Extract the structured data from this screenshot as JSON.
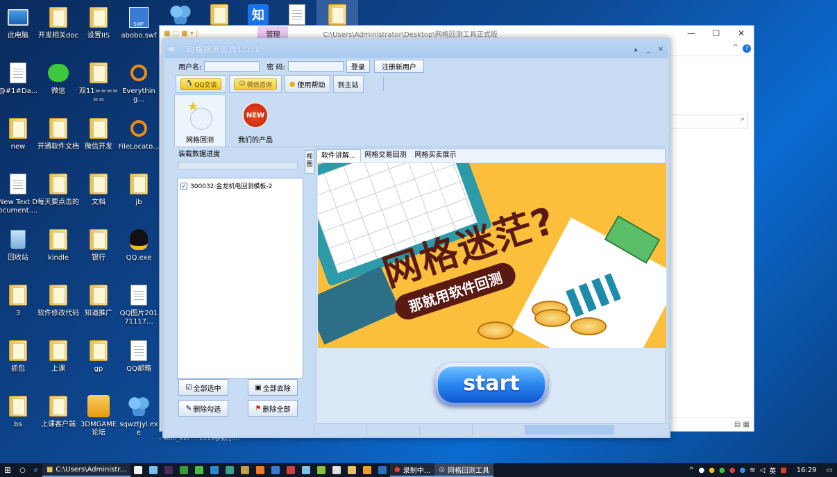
{
  "desktop_icons": [
    {
      "label": "此电脑",
      "icon": "pc-icon"
    },
    {
      "label": "开发相关doc",
      "icon": "folder-icon"
    },
    {
      "label": "设置IIS",
      "icon": "folder-icon"
    },
    {
      "label": "abobo.swf",
      "icon": "swf-icon"
    },
    {
      "label": "@#1#Da...",
      "icon": "document-icon"
    },
    {
      "label": "微信",
      "icon": "wechat-icon"
    },
    {
      "label": "双11======",
      "icon": "folder-icon"
    },
    {
      "label": "Everything...",
      "icon": "search-icon"
    },
    {
      "label": "new",
      "icon": "folder-icon"
    },
    {
      "label": "开通软件文档",
      "icon": "folder-icon"
    },
    {
      "label": "微信开发",
      "icon": "folder-icon"
    },
    {
      "label": "FileLocato...",
      "icon": "search-icon"
    },
    {
      "label": "New Text Document....",
      "icon": "document-icon"
    },
    {
      "label": "每天要点击的",
      "icon": "folder-icon"
    },
    {
      "label": "文档",
      "icon": "folder-icon"
    },
    {
      "label": "jb",
      "icon": "folder-icon"
    },
    {
      "label": "回收站",
      "icon": "recycle-bin-icon"
    },
    {
      "label": "kindle",
      "icon": "folder-icon"
    },
    {
      "label": "银行",
      "icon": "folder-icon"
    },
    {
      "label": "QQ.exe",
      "icon": "qq-icon"
    },
    {
      "label": "3",
      "icon": "folder-icon"
    },
    {
      "label": "软件修改代码",
      "icon": "folder-icon"
    },
    {
      "label": "知道推广",
      "icon": "folder-icon"
    },
    {
      "label": "QQ图片20171117...",
      "icon": "document-icon"
    },
    {
      "label": "抓包",
      "icon": "folder-icon"
    },
    {
      "label": "上课",
      "icon": "folder-icon"
    },
    {
      "label": "gp",
      "icon": "folder-icon"
    },
    {
      "label": "QQ邮箱",
      "icon": "document-icon"
    },
    {
      "label": "bs",
      "icon": "folder-icon"
    },
    {
      "label": "上课客户端",
      "icon": "folder-icon"
    },
    {
      "label": "3DMGAME论坛",
      "icon": "game-icon"
    },
    {
      "label": "sqwztjyl.exe",
      "icon": "people-icon"
    }
  ],
  "top_row_icons": [
    "知"
  ],
  "explorer": {
    "manage_label": "管理",
    "path": "C:\\Users\\Administrator\\Desktop\\网格回测工具正式版",
    "status_left": "37",
    "status_line": "- leon_kin ...          1519参数小..."
  },
  "app": {
    "title": "网格回测工具1.1.1",
    "login": {
      "username_label": "用户名:",
      "password_label": "密  码:",
      "login_button": "登录",
      "register_button": "注册新用户"
    },
    "toolbar": {
      "qq_button": "QQ交谈",
      "wechat_button": "微信咨询",
      "help_button": "使用帮助",
      "site_button": "到主站"
    },
    "big_tabs": [
      {
        "label": "网格回测"
      },
      {
        "label": "我们的产品"
      }
    ],
    "new_badge": "NEW",
    "left_panel": {
      "title": "装载数据进度",
      "items": [
        {
          "label": "300032:金龙机电回测模板-2",
          "checked": true
        }
      ],
      "select_all": "全部选中",
      "deselect_all": "全部去除",
      "delete_checked": "删除勾选",
      "delete_all": "删除全部"
    },
    "collapse_tab": "视图",
    "tabs": [
      "软件讲解...",
      "网格交易回测",
      "网格买卖展示"
    ],
    "banner": {
      "headline": "网格迷茫?",
      "subline": "那就用软件回测"
    },
    "start_label": "start"
  },
  "taskbar": {
    "explorer_task": "C:\\Users\\Administr...",
    "recording_task": "录制中...",
    "app_task": "网格回测工具",
    "ime": "英",
    "time": "16:29"
  }
}
